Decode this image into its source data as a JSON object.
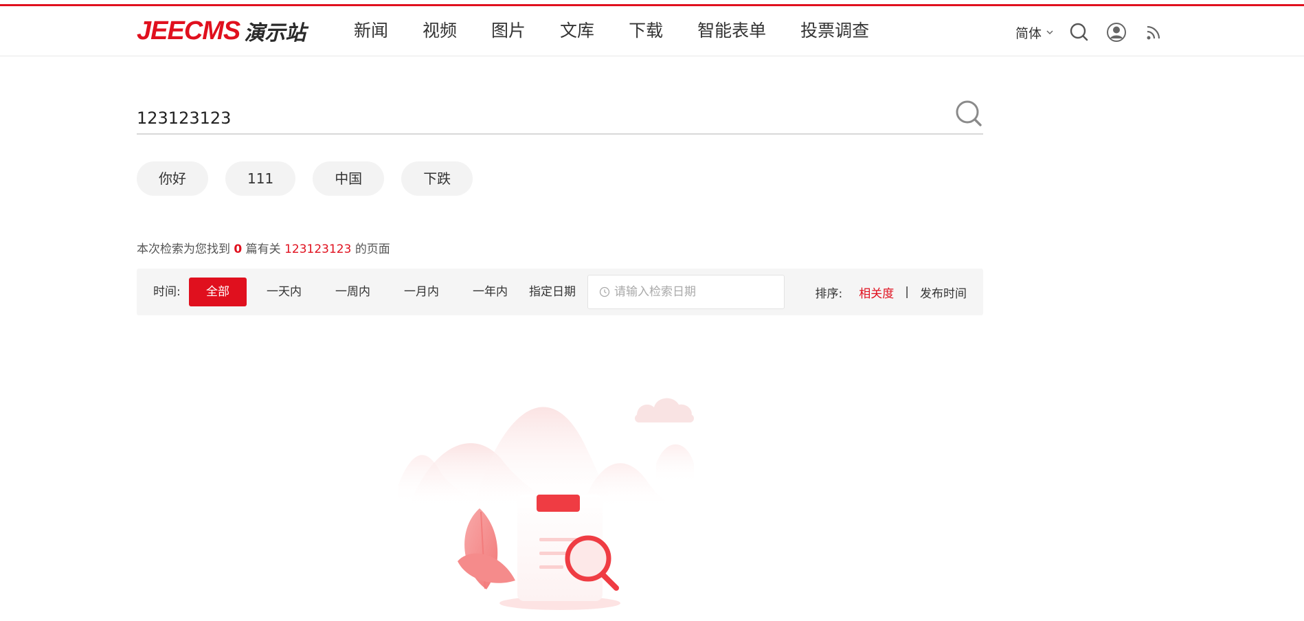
{
  "header": {
    "logo_brand": "JEECMS",
    "logo_suffix": "演示站",
    "nav": [
      "新闻",
      "视频",
      "图片",
      "文库",
      "下载",
      "智能表单",
      "投票调查"
    ],
    "language": "简体",
    "icons": [
      "search-icon",
      "user-icon",
      "rss-icon"
    ]
  },
  "search": {
    "value": "123123123",
    "icon": "search-icon"
  },
  "hot_tags": [
    "你好",
    "111",
    "中国",
    "下跌"
  ],
  "result": {
    "prefix": "本次检索为您找到",
    "count": "0",
    "middle": "篇有关",
    "keyword": "123123123",
    "suffix": "的页面"
  },
  "filter": {
    "time_label": "时间:",
    "time_options": [
      "全部",
      "一天内",
      "一周内",
      "一月内",
      "一年内"
    ],
    "active_time": "全部",
    "date_label": "指定日期",
    "date_placeholder": "请输入检索日期",
    "sort_label": "排序:",
    "sort_options": [
      "相关度",
      "发布时间"
    ],
    "sort_separator": "|",
    "active_sort": "相关度"
  },
  "colors": {
    "accent": "#e0101e",
    "tag_bg": "#f3f3f3",
    "filter_bg": "#f5f5f5"
  }
}
